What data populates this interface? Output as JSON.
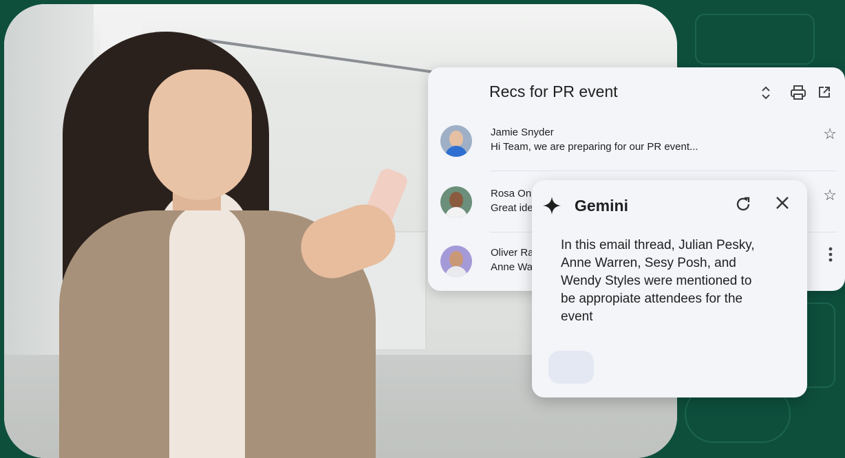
{
  "email_thread": {
    "title": "Recs for PR event",
    "icons": {
      "expand": "unfold-icon",
      "print": "print-icon",
      "open": "open-in-new-icon"
    },
    "messages": [
      {
        "sender": "Jamie Snyder",
        "snippet": "Hi Team, we are preparing for our PR event...",
        "action_icon": "star-icon"
      },
      {
        "sender": "Rosa Onu",
        "snippet": "Great idea",
        "action_icon": "star-icon"
      },
      {
        "sender": "Oliver Ra",
        "snippet": "Anne Wa",
        "action_icon": "more-vert-icon"
      }
    ]
  },
  "gemini_panel": {
    "title": "Gemini",
    "icons": {
      "brand": "gemini-sparkle-icon",
      "refresh": "refresh-icon",
      "close": "close-icon"
    },
    "response": "In this email thread, Julian Pesky, Anne Warren, Sesy Posh, and Wendy Styles were mentioned to be appropiate attendees for the event"
  },
  "colors": {
    "background": "#0e4f3c",
    "card": "#f3f5f9",
    "chip": "#e3e8f2"
  }
}
